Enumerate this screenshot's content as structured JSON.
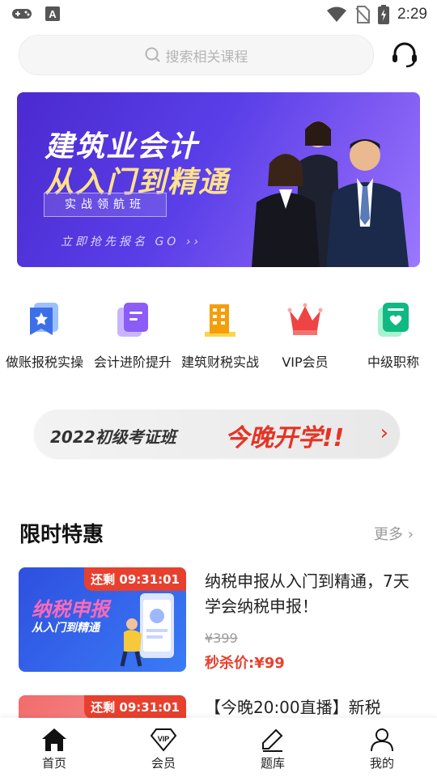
{
  "status_bar": {
    "time": "2:29"
  },
  "search": {
    "placeholder": "搜索相关课程"
  },
  "banner": {
    "line1": "建筑业会计",
    "line2": "从入门到精通",
    "tag": "实战领航班",
    "cta": "立即抢先报名 GO ››"
  },
  "categories": [
    {
      "label": "做账报税实操",
      "icon": "star-bookmark-icon",
      "color": "#4a7ef5"
    },
    {
      "label": "会计进阶提升",
      "icon": "document-icon",
      "color": "#8b5cf6"
    },
    {
      "label": "建筑财税实战",
      "icon": "building-icon",
      "color": "#f59e0b"
    },
    {
      "label": "VIP会员",
      "icon": "crown-icon",
      "color": "#ef4444"
    },
    {
      "label": "中级职称",
      "icon": "certificate-icon",
      "color": "#10b981"
    }
  ],
  "promo": {
    "text1": "2022初级考证班",
    "text2": "今晚开学!!",
    "arrow": "›"
  },
  "section": {
    "title": "限时特惠",
    "more": "更多 ›"
  },
  "courses": [
    {
      "countdown": "还剩 09:31:01",
      "thumb_title": "纳税申报",
      "thumb_sub": "从入门到精通",
      "title": "纳税申报从入门到精通，7天学会纳税申报！",
      "original_price": "¥399",
      "sale_price": "秒杀价:¥99"
    },
    {
      "countdown": "还剩 09:31:01",
      "title": "【今晚20:00直播】新税"
    }
  ],
  "nav": [
    {
      "label": "首页",
      "icon": "home-icon"
    },
    {
      "label": "会员",
      "icon": "vip-icon"
    },
    {
      "label": "题库",
      "icon": "pen-icon"
    },
    {
      "label": "我的",
      "icon": "user-icon"
    }
  ]
}
